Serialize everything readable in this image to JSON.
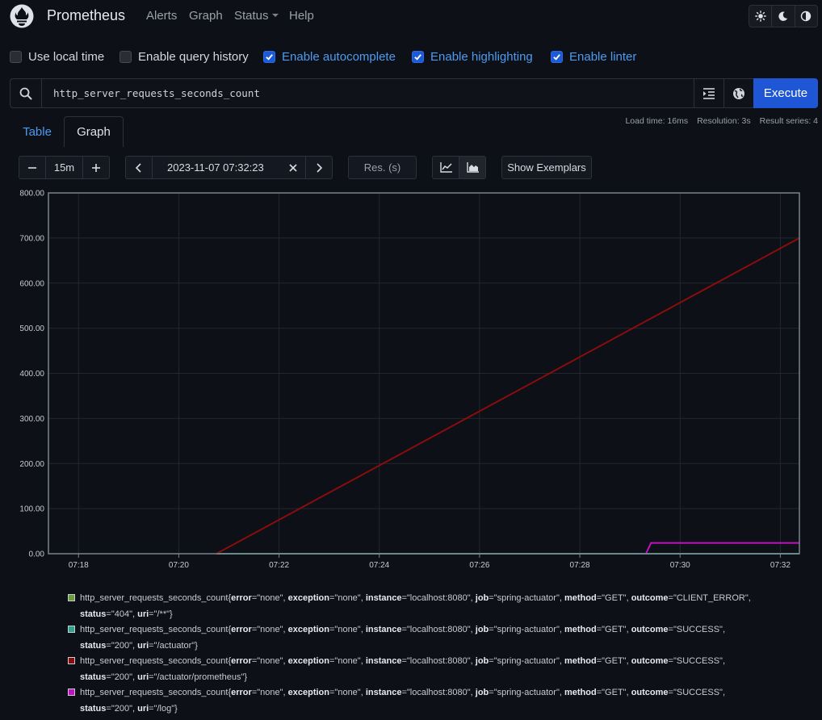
{
  "navbar": {
    "brand": "Prometheus",
    "items": [
      {
        "label": "Alerts"
      },
      {
        "label": "Graph"
      },
      {
        "label": "Status",
        "has_dropdown": true
      },
      {
        "label": "Help"
      }
    ],
    "theme_buttons": [
      "light-theme-icon",
      "dark-theme-icon",
      "auto-theme-icon"
    ]
  },
  "options": [
    {
      "label": "Use local time",
      "checked": false
    },
    {
      "label": "Enable query history",
      "checked": false
    },
    {
      "label": "Enable autocomplete",
      "checked": true
    },
    {
      "label": "Enable highlighting",
      "checked": true
    },
    {
      "label": "Enable linter",
      "checked": true
    }
  ],
  "query": {
    "expression": "http_server_requests_seconds_count",
    "execute_label": "Execute"
  },
  "tabs": {
    "table": "Table",
    "graph": "Graph",
    "active": "graph"
  },
  "stats": {
    "load_time": "Load time: 16ms",
    "resolution": "Resolution: 3s",
    "result_series": "Result series: 4"
  },
  "controls": {
    "range": "15m",
    "end_time": "2023-11-07 07:32:23",
    "resolution_placeholder": "Res. (s)",
    "exemplars_label": "Show Exemplars"
  },
  "colors": {
    "accent": "#1f56d6",
    "link": "#4d9bf0"
  },
  "chart_data": {
    "type": "line",
    "x_ticks": [
      "07:18",
      "07:20",
      "07:22",
      "07:24",
      "07:26",
      "07:28",
      "07:30",
      "07:32"
    ],
    "y_ticks": [
      "800.00",
      "700.00",
      "600.00",
      "500.00",
      "400.00",
      "300.00",
      "200.00",
      "100.00",
      "0.00"
    ],
    "ylim": [
      0,
      800
    ],
    "xlim_minutes": [
      17.4,
      32.38
    ],
    "grid": true,
    "series": [
      {
        "color": "#6b9e3b",
        "points": [
          [
            20.75,
            0
          ],
          [
            32.38,
            0
          ]
        ]
      },
      {
        "color": "#2ea38c",
        "points": [
          [
            20.75,
            0
          ],
          [
            32.38,
            0
          ]
        ]
      },
      {
        "color": "#8b0c0c",
        "points": [
          [
            20.75,
            0
          ],
          [
            32.38,
            700
          ]
        ]
      },
      {
        "color": "#c012c0",
        "points": [
          [
            29.32,
            0
          ],
          [
            29.42,
            24
          ],
          [
            32.38,
            24
          ]
        ]
      }
    ]
  },
  "legend": [
    {
      "color": "#6b9e3b",
      "metric": "http_server_requests_seconds_count",
      "labels": [
        {
          "k": "error",
          "v": "\"none\""
        },
        {
          "k": "exception",
          "v": "\"none\""
        },
        {
          "k": "instance",
          "v": "\"localhost:8080\""
        },
        {
          "k": "job",
          "v": "\"spring-actuator\""
        },
        {
          "k": "method",
          "v": "\"GET\""
        },
        {
          "k": "outcome",
          "v": "\"CLIENT_ERROR\""
        },
        {
          "k": "status",
          "v": "\"404\""
        },
        {
          "k": "uri",
          "v": "\"/**\""
        }
      ]
    },
    {
      "color": "#2ea38c",
      "metric": "http_server_requests_seconds_count",
      "labels": [
        {
          "k": "error",
          "v": "\"none\""
        },
        {
          "k": "exception",
          "v": "\"none\""
        },
        {
          "k": "instance",
          "v": "\"localhost:8080\""
        },
        {
          "k": "job",
          "v": "\"spring-actuator\""
        },
        {
          "k": "method",
          "v": "\"GET\""
        },
        {
          "k": "outcome",
          "v": "\"SUCCESS\""
        },
        {
          "k": "status",
          "v": "\"200\""
        },
        {
          "k": "uri",
          "v": "\"/actuator\""
        }
      ]
    },
    {
      "color": "#8b0c0c",
      "metric": "http_server_requests_seconds_count",
      "labels": [
        {
          "k": "error",
          "v": "\"none\""
        },
        {
          "k": "exception",
          "v": "\"none\""
        },
        {
          "k": "instance",
          "v": "\"localhost:8080\""
        },
        {
          "k": "job",
          "v": "\"spring-actuator\""
        },
        {
          "k": "method",
          "v": "\"GET\""
        },
        {
          "k": "outcome",
          "v": "\"SUCCESS\""
        },
        {
          "k": "status",
          "v": "\"200\""
        },
        {
          "k": "uri",
          "v": "\"/actuator/prometheus\""
        }
      ]
    },
    {
      "color": "#c012c0",
      "metric": "http_server_requests_seconds_count",
      "labels": [
        {
          "k": "error",
          "v": "\"none\""
        },
        {
          "k": "exception",
          "v": "\"none\""
        },
        {
          "k": "instance",
          "v": "\"localhost:8080\""
        },
        {
          "k": "job",
          "v": "\"spring-actuator\""
        },
        {
          "k": "method",
          "v": "\"GET\""
        },
        {
          "k": "outcome",
          "v": "\"SUCCESS\""
        },
        {
          "k": "status",
          "v": "\"200\""
        },
        {
          "k": "uri",
          "v": "\"/log\""
        }
      ]
    }
  ]
}
